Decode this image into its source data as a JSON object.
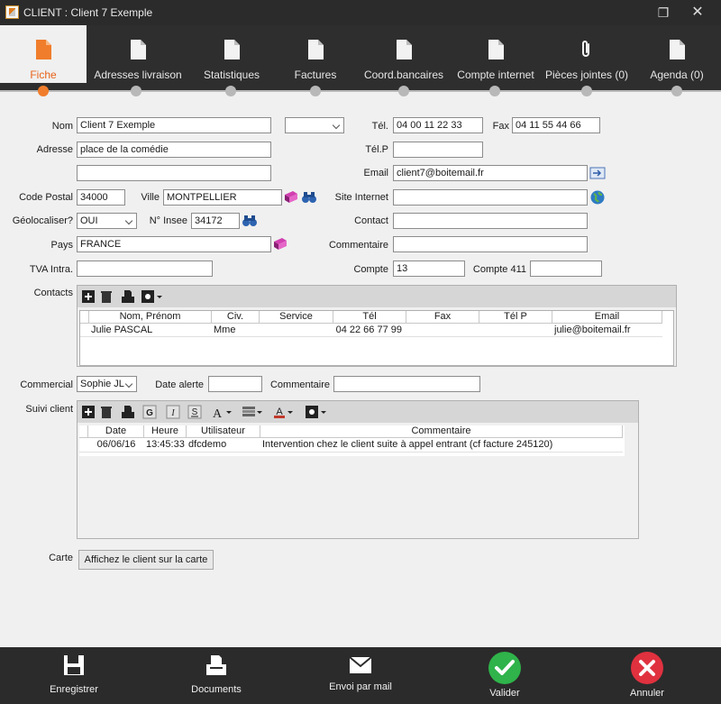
{
  "window": {
    "title": "CLIENT : Client 7 Exemple",
    "restore_glyph": "❐",
    "close_glyph": "✕"
  },
  "tabs": [
    {
      "label": "Fiche",
      "icon": "document-icon",
      "active": true
    },
    {
      "label": "Adresses livraison",
      "icon": "document-icon"
    },
    {
      "label": "Statistiques",
      "icon": "document-icon"
    },
    {
      "label": "Factures",
      "icon": "document-icon"
    },
    {
      "label": "Coord.bancaires",
      "icon": "document-icon"
    },
    {
      "label": "Compte internet",
      "icon": "document-icon"
    },
    {
      "label": "Pièces jointes (0)",
      "icon": "paperclip-icon"
    },
    {
      "label": "Agenda (0)",
      "icon": "document-icon"
    }
  ],
  "form": {
    "nom_label": "Nom",
    "nom_value": "Client 7 Exemple",
    "civilite_value": "",
    "tel_label": "Tél.",
    "tel_value": "04 00 11 22 33",
    "fax_label": "Fax",
    "fax_value": "04 11 55 44 66",
    "adresse_label": "Adresse",
    "adresse_value": "place de la comédie",
    "adresse2_value": "",
    "telp_label": "Tél.P",
    "telp_value": "",
    "email_label": "Email",
    "email_value": "client7@boitemail.fr",
    "cp_label": "Code Postal",
    "cp_value": "34000",
    "ville_label": "Ville",
    "ville_value": "MONTPELLIER",
    "site_label": "Site Internet",
    "site_value": "",
    "geo_label": "Géolocaliser?",
    "geo_value": "OUI",
    "insee_label": "N° Insee",
    "insee_value": "34172",
    "contact_label": "Contact",
    "contact_value": "",
    "pays_label": "Pays",
    "pays_value": "FRANCE",
    "commentaire_label": "Commentaire",
    "commentaire_value": "",
    "tva_label": "TVA Intra.",
    "tva_value": "",
    "compte_label": "Compte",
    "compte_value": "13",
    "compte411_label": "Compte 411",
    "compte411_value": ""
  },
  "contacts": {
    "label": "Contacts",
    "columns": [
      "Nom, Prénom",
      "Civ.",
      "Service",
      "Tél",
      "Fax",
      "Tél P",
      "Email"
    ],
    "rows": [
      [
        "Julie PASCAL",
        "Mme",
        "",
        "04 22 66 77 99",
        "",
        "",
        "julie@boitemail.fr"
      ]
    ]
  },
  "commercial": {
    "label": "Commercial",
    "value": "Sophie JL",
    "date_alerte_label": "Date alerte",
    "date_alerte_value": "",
    "commentaire_label": "Commentaire",
    "commentaire_value": ""
  },
  "suivi": {
    "label": "Suivi client",
    "columns": [
      "Date",
      "Heure",
      "Utilisateur",
      "Commentaire"
    ],
    "rows": [
      [
        "06/06/16",
        "13:45:33",
        "dfcdemo",
        "Intervention chez le client suite à appel entrant (cf facture 245120)"
      ]
    ]
  },
  "carte": {
    "label": "Carte",
    "button": "Affichez le client sur la carte"
  },
  "bottom": [
    {
      "label": "Enregistrer",
      "icon": "save-icon"
    },
    {
      "label": "Documents",
      "icon": "printer-icon"
    },
    {
      "label": "Envoi par mail",
      "icon": "mail-icon"
    },
    {
      "label": "Valider",
      "icon": "check-icon",
      "color": "#2fb34a"
    },
    {
      "label": "Annuler",
      "icon": "cancel-icon",
      "color": "#e0313f"
    }
  ],
  "colors": {
    "accent": "#f07d2b",
    "titlebar": "#2b2b2b",
    "valider": "#2fb34a",
    "annuler": "#e0313f"
  }
}
